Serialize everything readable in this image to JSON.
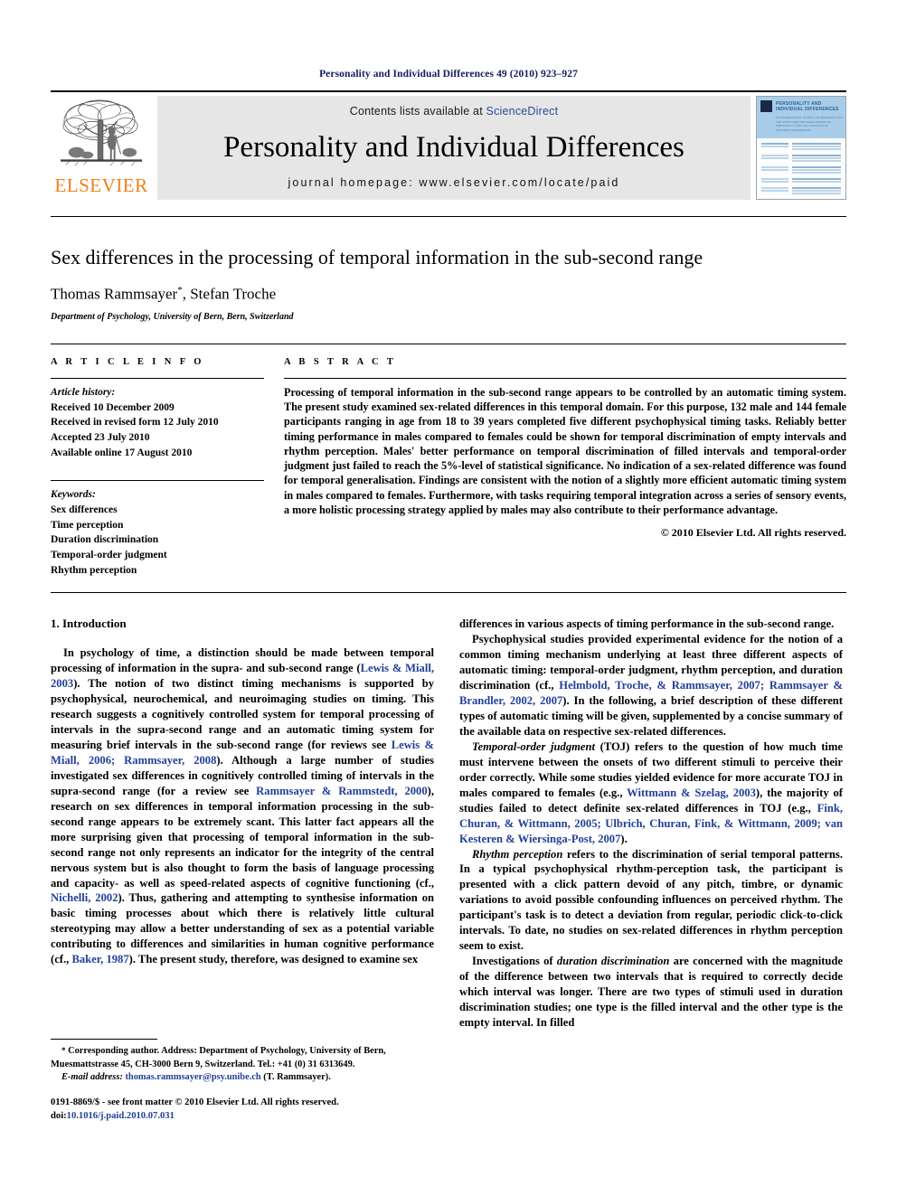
{
  "running_head": "Personality and Individual Differences 49 (2010) 923–927",
  "masthead": {
    "publisher_wordmark": "ELSEVIER",
    "contents_prefix": "Contents lists available at ",
    "sciencedirect": "ScienceDirect",
    "journal_title": "Personality and Individual Differences",
    "homepage": "journal homepage: www.elsevier.com/locate/paid",
    "cover": {
      "title_line1": "PERSONALITY AND",
      "title_line2": "INDIVIDUAL DIFFERENCES",
      "subtitle": "AN INTERNATIONAL JOURNAL OF RESEARCH INTO THE STRUCTURE AND DEVELOPMENT OF PERSONALITY AND THE CAUSATION OF INDIVIDUAL DIFFERENCES"
    }
  },
  "article": {
    "title": "Sex differences in the processing of temporal information in the sub-second range",
    "authors": "Thomas Rammsayer",
    "author_star": "*",
    "authors_rest": ", Stefan Troche",
    "affiliation": "Department of Psychology, University of Bern, Bern, Switzerland"
  },
  "article_info": {
    "heading": "A R T I C L E   I N F O",
    "history_label": "Article history:",
    "history": [
      "Received 10 December 2009",
      "Received in revised form 12 July 2010",
      "Accepted 23 July 2010",
      "Available online 17 August 2010"
    ],
    "keywords_label": "Keywords:",
    "keywords": [
      "Sex differences",
      "Time perception",
      "Duration discrimination",
      "Temporal-order judgment",
      "Rhythm perception"
    ]
  },
  "abstract": {
    "heading": "A B S T R A C T",
    "text": "Processing of temporal information in the sub-second range appears to be controlled by an automatic timing system. The present study examined sex-related differences in this temporal domain. For this purpose, 132 male and 144 female participants ranging in age from 18 to 39 years completed five different psychophysical timing tasks. Reliably better timing performance in males compared to females could be shown for temporal discrimination of empty intervals and rhythm perception. Males' better performance on temporal discrimination of filled intervals and temporal-order judgment just failed to reach the 5%-level of statistical significance. No indication of a sex-related difference was found for temporal generalisation. Findings are consistent with the notion of a slightly more efficient automatic timing system in males compared to females. Furthermore, with tasks requiring temporal integration across a series of sensory events, a more holistic processing strategy applied by males may also contribute to their performance advantage.",
    "copyright": "© 2010 Elsevier Ltd. All rights reserved."
  },
  "body": {
    "section_heading": "1. Introduction",
    "left": {
      "p1_a": "In psychology of time, a distinction should be made between temporal processing of information in the supra- and sub-second range (",
      "p1_cit1": "Lewis & Miall, 2003",
      "p1_b": "). The notion of two distinct timing mechanisms is supported by psychophysical, neurochemical, and neuroimaging studies on timing. This research suggests a cognitively controlled system for temporal processing of intervals in the supra-second range and an automatic timing system for measuring brief intervals in the sub-second range (for reviews see ",
      "p1_cit2": "Lewis & Miall, 2006; Rammsayer, 2008",
      "p1_c": "). Although a large number of studies investigated sex differences in cognitively controlled timing of intervals in the supra-second range (for a review see ",
      "p1_cit3": "Rammsayer & Rammstedt, 2000",
      "p1_d": "), research on sex differences in temporal information processing in the sub-second range appears to be extremely scant. This latter fact appears all the more surprising given that processing of temporal information in the sub-second range not only represents an indicator for the integrity of the central nervous system but is also thought to form the basis of language processing and capacity- as well as speed-related aspects of cognitive functioning (cf., ",
      "p1_cit4": "Nichelli, 2002",
      "p1_e": "). Thus, gathering and attempting to synthesise information on basic timing processes about which there is relatively little cultural stereotyping may allow a better understanding of sex as a potential variable contributing to differences and similarities in human cognitive performance (cf., ",
      "p1_cit5": "Baker, 1987",
      "p1_f": "). The present study, therefore, was designed to examine sex"
    },
    "right": {
      "p1": "differences in various aspects of timing performance in the sub-second range.",
      "p2_a": "Psychophysical studies provided experimental evidence for the notion of a common timing mechanism underlying at least three different aspects of automatic timing: temporal-order judgment, rhythm perception, and duration discrimination (cf., ",
      "p2_cit": "Helmbold, Troche, & Rammsayer, 2007; Rammsayer & Brandler, 2002, 2007",
      "p2_b": "). In the following, a brief description of these different types of automatic timing will be given, supplemented by a concise summary of the available data on respective sex-related differences.",
      "p3_term": "Temporal-order judgment",
      "p3_a": " (TOJ) refers to the question of how much time must intervene between the onsets of two different stimuli to perceive their order correctly. While some studies yielded evidence for more accurate TOJ in males compared to females (e.g., ",
      "p3_cit1": "Wittmann & Szelag, 2003",
      "p3_b": "), the majority of studies failed to detect definite sex-related differences in TOJ (e.g., ",
      "p3_cit2": "Fink, Churan, & Wittmann, 2005; Ulbrich, Churan, Fink, & Wittmann, 2009; van Kesteren & Wiersinga-Post, 2007",
      "p3_c": ").",
      "p4_term": "Rhythm perception",
      "p4_a": " refers to the discrimination of serial temporal patterns. In a typical psychophysical rhythm-perception task, the participant is presented with a click pattern devoid of any pitch, timbre, or dynamic variations to avoid possible confounding influences on perceived rhythm. The participant's task is to detect a deviation from regular, periodic click-to-click intervals. To date, no studies on sex-related differences in rhythm perception seem to exist.",
      "p5_a": "Investigations of ",
      "p5_term": "duration discrimination",
      "p5_b": " are concerned with the magnitude of the difference between two intervals that is required to correctly decide which interval was longer. There are two types of stimuli used in duration discrimination studies; one type is the filled interval and the other type is the empty interval. In filled"
    }
  },
  "footnote": {
    "star": "*",
    "corresponding_a": " Corresponding author. Address: Department of Psychology, University of Bern, Muesmattstrasse 45, CH-3000 Bern 9, Switzerland. Tel.: +41 (0) 31 6313649.",
    "email_label": "E-mail address:",
    "email": "thomas.rammsayer@psy.unibe.ch",
    "email_suffix": " (T. Rammsayer).",
    "issn_line": "0191-8869/$ - see front matter © 2010 Elsevier Ltd. All rights reserved.",
    "doi_label": "doi:",
    "doi_value": "10.1016/j.paid.2010.07.031"
  },
  "colors": {
    "header_blue": "#141b60",
    "link_blue": "#22409a",
    "elsevier_orange": "#f07f1a",
    "banner_grey": "#e6e6e6",
    "cover_blue": "#a9cde9"
  }
}
